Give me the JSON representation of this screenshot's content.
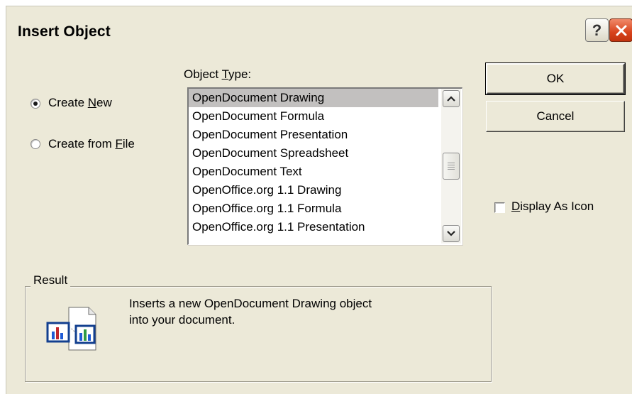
{
  "dialog": {
    "title": "Insert Object",
    "help_glyph": "?",
    "close_icon": "close-icon"
  },
  "options": {
    "create_new": {
      "prefix": "Create ",
      "mnemonic": "N",
      "suffix": "ew",
      "checked": true
    },
    "create_from_file": {
      "prefix": "Create from ",
      "mnemonic": "F",
      "suffix": "ile",
      "checked": false
    }
  },
  "object_type": {
    "label_prefix": "Object ",
    "label_mnemonic": "T",
    "label_suffix": "ype:",
    "selected_index": 0,
    "items": [
      "OpenDocument Drawing",
      "OpenDocument Formula",
      "OpenDocument Presentation",
      "OpenDocument Spreadsheet",
      "OpenDocument Text",
      "OpenOffice.org 1.1 Drawing",
      "OpenOffice.org 1.1 Formula",
      "OpenOffice.org 1.1 Presentation"
    ]
  },
  "buttons": {
    "ok": "OK",
    "cancel": "Cancel"
  },
  "display_as_icon": {
    "mnemonic": "D",
    "suffix": "isplay As Icon",
    "checked": false
  },
  "result": {
    "group_label": "Result",
    "line1": "Inserts a new OpenDocument Drawing object",
    "line2": "into your document.",
    "icon": "insert-object-result-icon"
  },
  "colors": {
    "dialog_bg": "#ece9d8",
    "selection_bg": "#c2c0bf",
    "close_red": "#d8431c"
  }
}
